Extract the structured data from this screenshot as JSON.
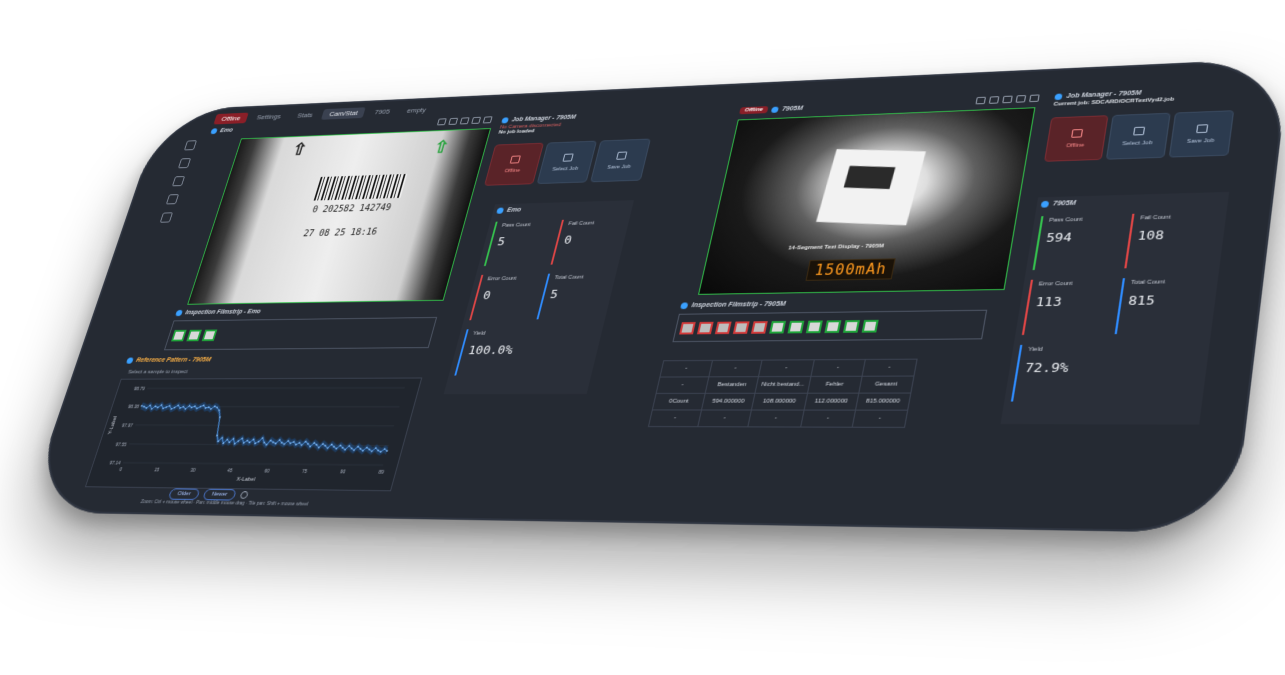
{
  "tabs": [
    "Offline",
    "Settings",
    "Stats",
    "Cam/Stat",
    "7905",
    "empty"
  ],
  "left_camera": {
    "title": "Emo",
    "ocr_digits": "0 202582 142749",
    "ocr_datetime": "27 08 25   18:16"
  },
  "filmstrip_left": {
    "title": "Inspection Filmstrip - Emo"
  },
  "reference_pattern": {
    "title": "Reference Pattern - 7905M",
    "hint": "Select a sample to inspect",
    "older": "Older",
    "newer": "Newer",
    "footer": "Zoom: Ctrl + mouse wheel · Pan: middle mouse drag · Tile pan: Shift + mouse wheel"
  },
  "chart_data": {
    "type": "line",
    "title": "",
    "xlabel": "X-Label",
    "ylabel": "Y-Label",
    "xlim": [
      0,
      89
    ],
    "ylim": [
      97.14,
      98.79
    ],
    "x_ticks": [
      "0",
      "15",
      "30",
      "45",
      "60",
      "75",
      "90",
      "89"
    ],
    "y_ticks": [
      "98.79",
      "98.38",
      "97.97",
      "97.55",
      "97.14"
    ],
    "series": [
      {
        "values": [
          98.4,
          98.38,
          98.35,
          98.41,
          98.33,
          98.39,
          98.36,
          98.42,
          98.34,
          98.37,
          98.4,
          98.33,
          98.36,
          98.41,
          98.35,
          98.38,
          98.33,
          98.4,
          98.36,
          98.39,
          98.34,
          98.38,
          98.41,
          98.35,
          98.37,
          98.33,
          98.39,
          98.36,
          98.3,
          98.15,
          97.75,
          97.62,
          97.7,
          97.58,
          97.66,
          97.6,
          97.68,
          97.57,
          97.63,
          97.69,
          97.59,
          97.64,
          97.6,
          97.67,
          97.58,
          97.62,
          97.7,
          97.6,
          97.55,
          97.65,
          97.61,
          97.58,
          97.66,
          97.6,
          97.57,
          97.64,
          97.59,
          97.62,
          97.56,
          97.6,
          97.55,
          97.63,
          97.58,
          97.52,
          97.6,
          97.56,
          97.5,
          97.58,
          97.54,
          97.49,
          97.57,
          97.52,
          97.48,
          97.55,
          97.5,
          97.46,
          97.54,
          97.49,
          97.45,
          97.53,
          97.48,
          97.44,
          97.51,
          97.47,
          97.43,
          97.5,
          97.45,
          97.42,
          97.48,
          97.44
        ]
      }
    ]
  },
  "job_manager_left": {
    "title": "Job Manager - 7905M",
    "status": "No Camera disconnected",
    "job": "No job loaded",
    "offline": "Offline",
    "select": "Select Job",
    "save": "Save Job"
  },
  "stats_left": {
    "title": "Emo",
    "pass_label": "Pass Count",
    "pass": "5",
    "fail_label": "Fail Count",
    "fail": "0",
    "error_label": "Error Count",
    "error": "0",
    "total_label": "Total Count",
    "total": "5",
    "yield_label": "Yield",
    "yield": "100.0%"
  },
  "right_camera": {
    "badge": "Offline",
    "title": "7905M",
    "seg_title": "14-Segment Text Display - 7905M",
    "seg_value": "1500mAh"
  },
  "filmstrip_right": {
    "title": "Inspection Filmstrip - 7905M"
  },
  "job_manager_right": {
    "title": "Job Manager - 7905M",
    "current": "Current job: SDCARD/OCRTextVyd2.job",
    "offline": "Offline",
    "select": "Select Job",
    "save": "Save Job"
  },
  "stats_right": {
    "title": "7905M",
    "pass_label": "Pass Count",
    "pass": "594",
    "fail_label": "Fail Count",
    "fail": "108",
    "error_label": "Error Count",
    "error": "113",
    "total_label": "Total Count",
    "total": "815",
    "yield_label": "Yield",
    "yield": "72.9%"
  },
  "grid_table": {
    "rows": [
      [
        "-",
        "-",
        "-",
        "-",
        "-"
      ],
      [
        "-",
        "Bestanden",
        "Nicht bestand...",
        "Fehler",
        "Gesamt"
      ],
      [
        "0Count",
        "594.000000",
        "108.000000",
        "112.000000",
        "815.000000"
      ],
      [
        "-",
        "-",
        "-",
        "-",
        "-"
      ]
    ]
  },
  "colors": {
    "pass": "#35c24e",
    "fail": "#e04646",
    "total": "#2f8cff",
    "yield": "#2f8cff"
  }
}
